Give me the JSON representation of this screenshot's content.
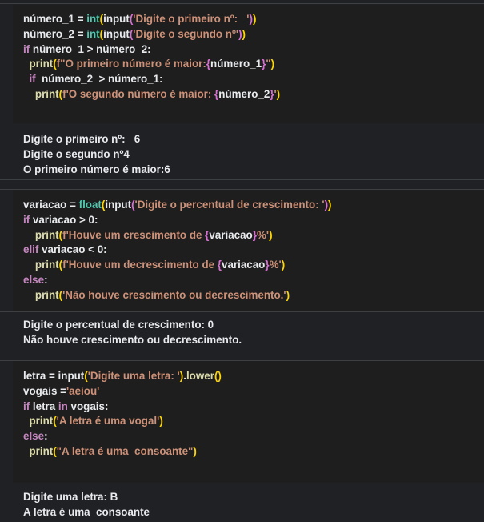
{
  "cell1": {
    "code": [
      [
        [
          "plain",
          "número_1 = "
        ],
        [
          "bi",
          "int"
        ],
        [
          "br",
          "("
        ],
        [
          "plain",
          "input"
        ],
        [
          "br2",
          "("
        ],
        [
          "str",
          "'Digite o primeiro nº:   '"
        ],
        [
          "br2",
          ")"
        ],
        [
          "br",
          ")"
        ]
      ],
      [
        [
          "plain",
          "número_2 = "
        ],
        [
          "bi",
          "int"
        ],
        [
          "br",
          "("
        ],
        [
          "plain",
          "input"
        ],
        [
          "br2",
          "("
        ],
        [
          "str",
          "'Digite o segundo nº'"
        ],
        [
          "br2",
          ")"
        ],
        [
          "br",
          ")"
        ]
      ],
      [
        [
          "kw",
          "if"
        ],
        [
          "plain",
          " número_1 > número_2:"
        ]
      ],
      [
        [
          "plain",
          "  "
        ],
        [
          "fn",
          "print"
        ],
        [
          "br",
          "("
        ],
        [
          "str",
          "f\"O primeiro número é maior:"
        ],
        [
          "br2",
          "{"
        ],
        [
          "plain",
          "número_1"
        ],
        [
          "br2",
          "}"
        ],
        [
          "str",
          "\""
        ],
        [
          "br",
          ")"
        ]
      ],
      [
        [
          "plain",
          "  "
        ],
        [
          "kw",
          "if"
        ],
        [
          "plain",
          "  número_2  > número_1:"
        ]
      ],
      [
        [
          "plain",
          "    "
        ],
        [
          "fn",
          "print"
        ],
        [
          "br",
          "("
        ],
        [
          "str",
          "f'O segundo número é maior: "
        ],
        [
          "br2",
          "{"
        ],
        [
          "plain",
          "número_2"
        ],
        [
          "br2",
          "}"
        ],
        [
          "str",
          "'"
        ],
        [
          "br",
          ")"
        ]
      ]
    ],
    "output": [
      "Digite o primeiro nº:   6",
      "Digite o segundo nº4",
      "O primeiro número é maior:6"
    ]
  },
  "cell2": {
    "code": [
      [
        [
          "plain",
          "variacao = "
        ],
        [
          "bi",
          "float"
        ],
        [
          "br",
          "("
        ],
        [
          "plain",
          "input"
        ],
        [
          "br2",
          "("
        ],
        [
          "str",
          "'Digite o percentual de crescimento: '"
        ],
        [
          "br2",
          ")"
        ],
        [
          "br",
          ")"
        ]
      ],
      [
        [
          "kw",
          "if"
        ],
        [
          "plain",
          " variacao > 0:"
        ]
      ],
      [
        [
          "plain",
          "    "
        ],
        [
          "fn",
          "print"
        ],
        [
          "br",
          "("
        ],
        [
          "str",
          "f'Houve um crescimento de "
        ],
        [
          "br2",
          "{"
        ],
        [
          "plain",
          "variacao"
        ],
        [
          "br2",
          "}"
        ],
        [
          "str",
          "%'"
        ],
        [
          "br",
          ")"
        ]
      ],
      [
        [
          "kw",
          "elif"
        ],
        [
          "plain",
          " variacao < 0:"
        ]
      ],
      [
        [
          "plain",
          "    "
        ],
        [
          "fn",
          "print"
        ],
        [
          "br",
          "("
        ],
        [
          "str",
          "f'Houve um decrescimento de "
        ],
        [
          "br2",
          "{"
        ],
        [
          "plain",
          "variacao"
        ],
        [
          "br2",
          "}"
        ],
        [
          "str",
          "%'"
        ],
        [
          "br",
          ")"
        ]
      ],
      [
        [
          "kw",
          "else"
        ],
        [
          "plain",
          ":"
        ]
      ],
      [
        [
          "plain",
          "    "
        ],
        [
          "fn",
          "print"
        ],
        [
          "br",
          "("
        ],
        [
          "str",
          "'Não houve crescimento ou decrescimento.'"
        ],
        [
          "br",
          ")"
        ]
      ]
    ],
    "output": [
      "Digite o percentual de crescimento: 0",
      "Não houve crescimento ou decrescimento."
    ]
  },
  "cell3": {
    "code": [
      [
        [
          "plain",
          "letra = "
        ],
        [
          "plain",
          "input"
        ],
        [
          "br",
          "("
        ],
        [
          "str",
          "'Digite uma letra: '"
        ],
        [
          "br",
          ")"
        ],
        [
          "plain",
          "."
        ],
        [
          "fn",
          "lower"
        ],
        [
          "br",
          "()"
        ]
      ],
      [
        [
          "plain",
          "vogais ="
        ],
        [
          "str",
          "'aeiou'"
        ]
      ],
      [
        [
          "kw",
          "if"
        ],
        [
          "plain",
          " letra "
        ],
        [
          "kw",
          "in"
        ],
        [
          "plain",
          " vogais:"
        ]
      ],
      [
        [
          "plain",
          "  "
        ],
        [
          "fn",
          "print"
        ],
        [
          "br",
          "("
        ],
        [
          "str",
          "'A letra é uma vogal'"
        ],
        [
          "br",
          ")"
        ]
      ],
      [
        [
          "kw",
          "else"
        ],
        [
          "plain",
          ":"
        ]
      ],
      [
        [
          "plain",
          "  "
        ],
        [
          "fn",
          "print"
        ],
        [
          "br",
          "("
        ],
        [
          "str",
          "\"A letra é uma  consoante\""
        ],
        [
          "br",
          ")"
        ]
      ]
    ],
    "output": [
      "Digite uma letra: B",
      "A letra é uma  consoante"
    ]
  }
}
